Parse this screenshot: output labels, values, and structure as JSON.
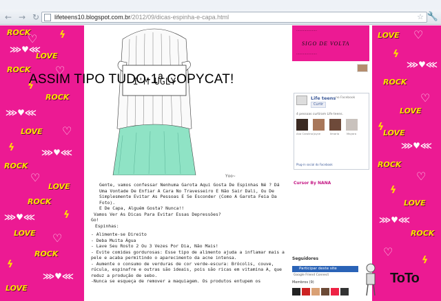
{
  "browser": {
    "url_host": "lifeteens10.blogspot.com.br",
    "url_path": "/2012/09/dicas-espinha-e-capa.html"
  },
  "post": {
    "title": "ASSIM TIPO TUDO-1ª COPYCAT!",
    "image_caption": "Yoo~",
    "sign_text": "I'M UGLY",
    "paragraphs": [
      "Gente, vamos confessar Nenhuma Garota Aqui Gosta De Espinhas Né ? Dá Uma Vontade De Enfiar A Cara No Travesseiro E Não Sair Dali, Ou De Simplesmente Evitar As Pessoas E Se Esconder (Como A Garota Feia Da Foto).",
      "E De Capa, Alguém Gosta? Nunca!!",
      "Vamos Ver As Dicas Para Evitar Essas Depressões?",
      "Go!",
      "Espinhas:",
      "- Alimente-se Direito",
      "- Deba Muita Água",
      "- Lave Seu Rosto 2 Ou 3 Vezes Por Dia, Não Mais!",
      "- Evite comidas gordurosas: Esse tipo de alimento ajuda a inflamar mais a pele e acaba permitindo o aparecimento da acne intensa.",
      "- Aumente o consumo de verduras de cor verde-escura: Brócolis, couve, rúcula, espinafre e outras são ideais, pois são ricas em vitamina A, que reduz a produção de sebo.",
      "-Nunca se esqueça de remover a maquiagem. Os produtos entupem os"
    ]
  },
  "sidebar": {
    "banner_text": "SIGO DE VOLTA",
    "facebook": {
      "page_name": "Life teens",
      "sub": "no Facebook",
      "like_label": "Curtir",
      "count_text": "4 pessoas curtiram Life teens.",
      "face_names": [
        "Ana Carolina",
        "Joyce",
        "Ilmarla",
        "Mayara"
      ],
      "plugin_text": "Plug-in social do Facebook"
    },
    "cursor_label": "Cursor By NANA",
    "followers_label": "Seguidores",
    "join_button": "Participar deste site",
    "join_sub": "Google Friend Connect",
    "members_label": "Membros (9)"
  },
  "decor": {
    "corner_text": "ToTo"
  },
  "colors": {
    "background_pink": "#ec1a93",
    "accent_yellow": "#ffe200",
    "facebook_blue": "#3b5998"
  }
}
